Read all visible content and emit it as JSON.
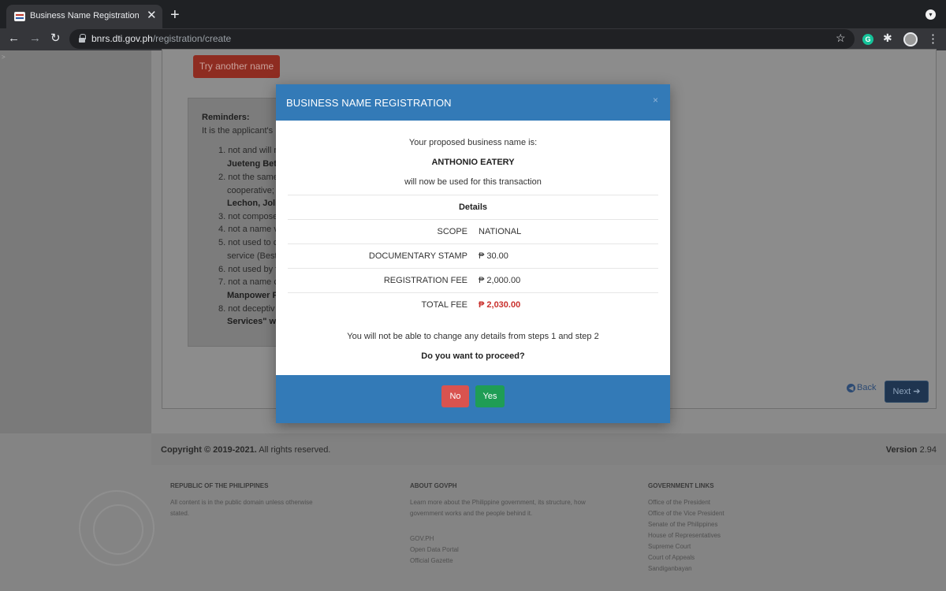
{
  "browser": {
    "tab_title": "Business Name Registration - D",
    "url_host": "bnrs.dti.gov.ph",
    "url_path": "/registration/create"
  },
  "page": {
    "try_another_label": "Try another name",
    "reminders": {
      "title": "Reminders:",
      "intro": "It is the applicant's r",
      "lines": [
        {
          "text": "1. not and will r",
          "bold": false
        },
        {
          "text": "Jueteng Bet",
          "bold": true
        },
        {
          "text": "2. not the same",
          "bold": false
        },
        {
          "text": "cooperative;",
          "bold": false
        },
        {
          "text": "Lechon, Joli",
          "bold": true
        },
        {
          "text": "3. not compose",
          "bold": false
        },
        {
          "text": "4. not a name v",
          "bold": false
        },
        {
          "text": "5. not used to c",
          "bold": false
        },
        {
          "text": "service (Best",
          "bold": false
        },
        {
          "text": "6. not used by f",
          "bold": false
        },
        {
          "text": "7. not a name c",
          "bold": false
        },
        {
          "text": "Manpower F",
          "bold": true
        },
        {
          "text": "8. not deceptiv",
          "bold": false
        },
        {
          "text": "Services\" w",
          "bold": false
        }
      ]
    },
    "back_label": "Back",
    "next_label": "Next",
    "copyright_bold": "Copyright © 2019-2021.",
    "copyright_rest": " All rights reserved.",
    "version_label": "Version",
    "version_value": " 2.94"
  },
  "footer": {
    "col1": {
      "heading": "REPUBLIC OF THE PHILIPPINES",
      "text": "All content is in the public domain unless otherwise stated."
    },
    "col2": {
      "heading": "ABOUT GOVPH",
      "text": "Learn more about the Philippine government, its structure, how government works and the people behind it.",
      "links": [
        "GOV.PH",
        "Open Data Portal",
        "Official Gazette"
      ]
    },
    "col3": {
      "heading": "GOVERNMENT LINKS",
      "links": [
        "Office of the President",
        "Office of the Vice President",
        "Senate of the Philippines",
        "House of Representatives",
        "Supreme Court",
        "Court of Appeals",
        "Sandiganbayan"
      ]
    }
  },
  "modal": {
    "title": "BUSINESS NAME REGISTRATION",
    "close": "×",
    "proposed_label": "Your proposed business name is:",
    "business_name": "ANTHONIO EATERY",
    "used_note": "will now be used for this transaction",
    "details_heading": "Details",
    "rows": [
      {
        "label": "SCOPE",
        "value": "NATIONAL"
      },
      {
        "label": "DOCUMENTARY STAMP",
        "value": "₱ 30.00"
      },
      {
        "label": "REGISTRATION FEE",
        "value": "₱ 2,000.00"
      },
      {
        "label": "TOTAL FEE",
        "value": "₱ 2,030.00"
      }
    ],
    "warning": "You will not be able to change any details from steps 1 and step 2",
    "question": "Do you want to proceed?",
    "no_label": "No",
    "yes_label": "Yes"
  },
  "colors": {
    "modal_header": "#337ab7",
    "no_button": "#d9534f",
    "yes_button": "#1f9d55",
    "total_fee": "#c9302c"
  }
}
